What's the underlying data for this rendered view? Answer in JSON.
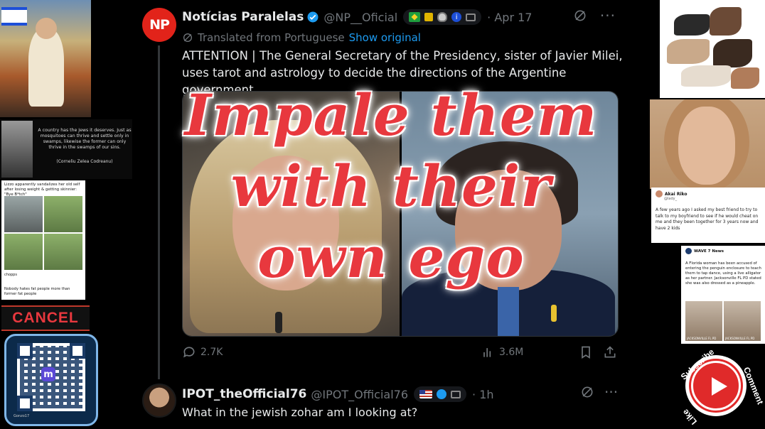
{
  "main_tweet": {
    "avatar_text": "NP",
    "author_name": "Notícias Paralelas",
    "handle": "@NP__Oficial",
    "date": "· Apr 17",
    "translated_label": "Translated from Portuguese",
    "show_original": "Show original",
    "text": "ATTENTION | The General Secretary of the Presidency, sister of Javier Milei, uses tarot and astrology to decide the directions of the Argentine government",
    "replies": "2.7K",
    "views": "3.6M",
    "icons": [
      "verified-icon",
      "brazil-flag-icon",
      "lock-icon",
      "shield-icon",
      "info-icon",
      "camera-icon",
      "grok-icon",
      "more-icon"
    ]
  },
  "reply_tweet": {
    "author_name": "IPOT_theOfficial76",
    "handle": "@IPOT_Official76",
    "date": "· 1h",
    "text": "What in the jewish zohar am I looking at?"
  },
  "overlay": {
    "lines": [
      "Impale them",
      "with their",
      "own ego"
    ],
    "color": "#e8383e"
  },
  "left_collage": {
    "quote_text": "A country has the Jews it deserves. Just as mosquitoes can thrive and settle only in swamps, likewise the former can only thrive in the swamps of our sins.",
    "quote_attr": "(Corneliu Zelea Codreanu)",
    "lizzo_text": "Lizzo apparently vandalizes her old self after losing weight & getting skinnier: \"Bye B*tch\"",
    "lizzo_user": "chopps",
    "lizzo_caption": "Nobody hates fat people more than former fat people",
    "cancel_label": "CANCEL",
    "qr_label": "Gonzo17"
  },
  "right_collage": {
    "tweet_user": "Akai Riko",
    "tweet_handle": "@lady_",
    "tweet_text": "A few years ago I asked my best friend to try to talk to my boyfriend to see if he would cheat on me and they been together for 3 years now and have 2 kids",
    "news_user": "WAVE 7 News",
    "news_text": "A Florida woman has been accused of entering the penguin enclosure to teach them to tap dance, using a live alligator as her partner. Jacksonville FL PD stated she was also dressed as a pineapple.",
    "mug_label_1": "JACKSONVILLE FL PD",
    "mug_label_2": "JACKSONVILLE FL PD",
    "subscribe": "Subscribe",
    "comment": "Comment",
    "like": "Like"
  }
}
